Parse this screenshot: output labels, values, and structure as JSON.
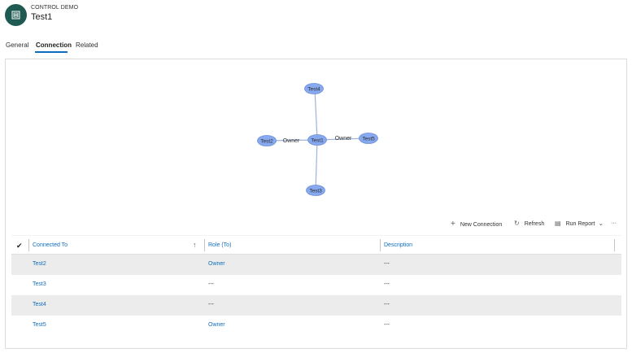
{
  "header": {
    "entity_type": "CONTROL DEMO",
    "title": "Test1"
  },
  "tabs": [
    {
      "label": "General",
      "active": false
    },
    {
      "label": "Connection",
      "active": true
    },
    {
      "label": "Related",
      "active": false
    }
  ],
  "graph": {
    "nodes": [
      "Test4",
      "Test2",
      "Test1",
      "Test5",
      "Test3"
    ],
    "edge_labels": {
      "left": "Owner",
      "right": "Owner"
    },
    "node_color": "#87a9f0"
  },
  "commands": {
    "new_connection": "New Connection",
    "refresh": "Refresh",
    "run_report": "Run Report",
    "more": "···"
  },
  "grid": {
    "columns": [
      "Connected To",
      "Role (To)",
      "Description"
    ],
    "rows": [
      {
        "connected_to": "Test2",
        "role": "Owner",
        "description": "---"
      },
      {
        "connected_to": "Test3",
        "role": "---",
        "description": "---"
      },
      {
        "connected_to": "Test4",
        "role": "---",
        "description": "---"
      },
      {
        "connected_to": "Test5",
        "role": "Owner",
        "description": "---"
      }
    ]
  },
  "colors": {
    "accent": "#0f6cbd",
    "entity_icon_bg": "#1e5a52"
  }
}
